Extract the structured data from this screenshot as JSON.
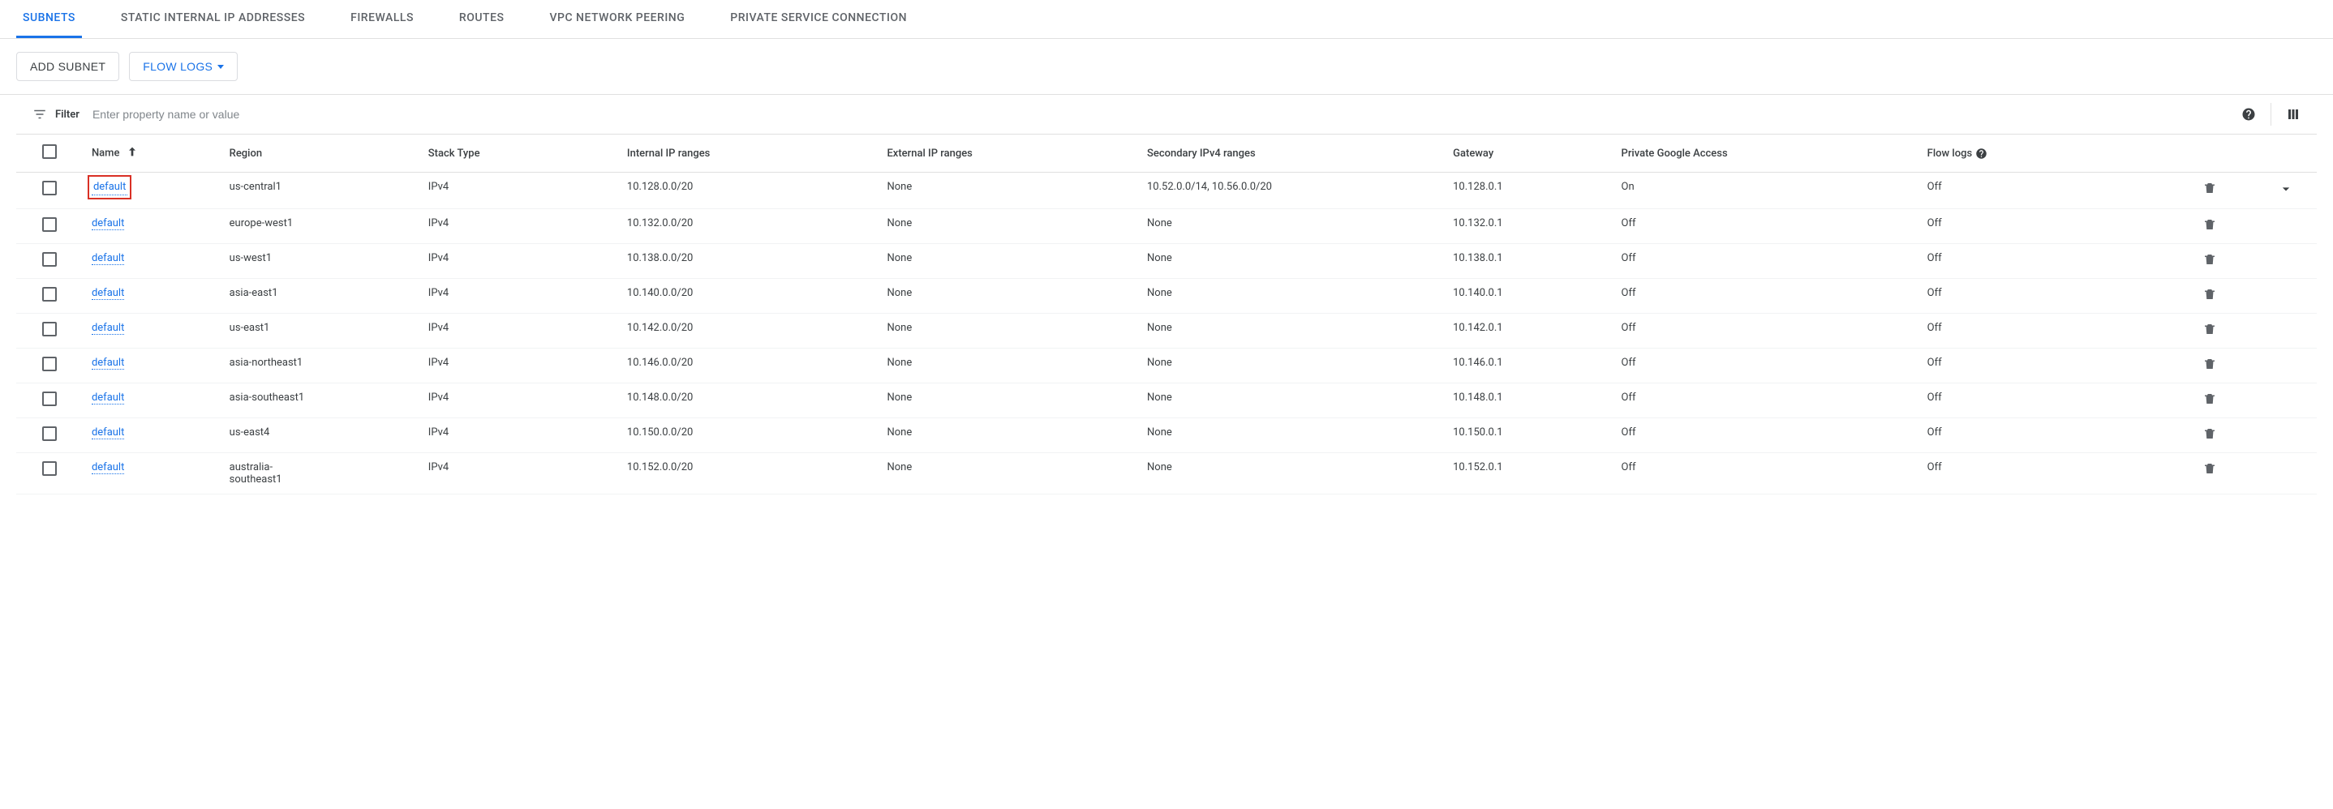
{
  "tabs": [
    {
      "label": "SUBNETS",
      "active": true
    },
    {
      "label": "STATIC INTERNAL IP ADDRESSES",
      "active": false
    },
    {
      "label": "FIREWALLS",
      "active": false
    },
    {
      "label": "ROUTES",
      "active": false
    },
    {
      "label": "VPC NETWORK PEERING",
      "active": false
    },
    {
      "label": "PRIVATE SERVICE CONNECTION",
      "active": false
    }
  ],
  "actions": {
    "add_subnet": "ADD SUBNET",
    "flow_logs": "FLOW LOGS"
  },
  "filter": {
    "label": "Filter",
    "placeholder": "Enter property name or value"
  },
  "columns": {
    "name": "Name",
    "region": "Region",
    "stack": "Stack Type",
    "internal": "Internal IP ranges",
    "external": "External IP ranges",
    "secondary": "Secondary IPv4 ranges",
    "gateway": "Gateway",
    "pga": "Private Google Access",
    "flow": "Flow logs"
  },
  "rows": [
    {
      "name": "default",
      "region": "us-central1",
      "stack": "IPv4",
      "internal": "10.128.0.0/20",
      "external": "None",
      "secondary": "10.52.0.0/14, 10.56.0.0/20",
      "gateway": "10.128.0.1",
      "pga": "On",
      "flow": "Off",
      "highlighted": true,
      "expandable": true
    },
    {
      "name": "default",
      "region": "europe-west1",
      "stack": "IPv4",
      "internal": "10.132.0.0/20",
      "external": "None",
      "secondary": "None",
      "gateway": "10.132.0.1",
      "pga": "Off",
      "flow": "Off"
    },
    {
      "name": "default",
      "region": "us-west1",
      "stack": "IPv4",
      "internal": "10.138.0.0/20",
      "external": "None",
      "secondary": "None",
      "gateway": "10.138.0.1",
      "pga": "Off",
      "flow": "Off"
    },
    {
      "name": "default",
      "region": "asia-east1",
      "stack": "IPv4",
      "internal": "10.140.0.0/20",
      "external": "None",
      "secondary": "None",
      "gateway": "10.140.0.1",
      "pga": "Off",
      "flow": "Off"
    },
    {
      "name": "default",
      "region": "us-east1",
      "stack": "IPv4",
      "internal": "10.142.0.0/20",
      "external": "None",
      "secondary": "None",
      "gateway": "10.142.0.1",
      "pga": "Off",
      "flow": "Off"
    },
    {
      "name": "default",
      "region": "asia-northeast1",
      "stack": "IPv4",
      "internal": "10.146.0.0/20",
      "external": "None",
      "secondary": "None",
      "gateway": "10.146.0.1",
      "pga": "Off",
      "flow": "Off"
    },
    {
      "name": "default",
      "region": "asia-southeast1",
      "stack": "IPv4",
      "internal": "10.148.0.0/20",
      "external": "None",
      "secondary": "None",
      "gateway": "10.148.0.1",
      "pga": "Off",
      "flow": "Off"
    },
    {
      "name": "default",
      "region": "us-east4",
      "stack": "IPv4",
      "internal": "10.150.0.0/20",
      "external": "None",
      "secondary": "None",
      "gateway": "10.150.0.1",
      "pga": "Off",
      "flow": "Off"
    },
    {
      "name": "default",
      "region": "australia-southeast1",
      "stack": "IPv4",
      "internal": "10.152.0.0/20",
      "external": "None",
      "secondary": "None",
      "gateway": "10.152.0.1",
      "pga": "Off",
      "flow": "Off"
    }
  ]
}
